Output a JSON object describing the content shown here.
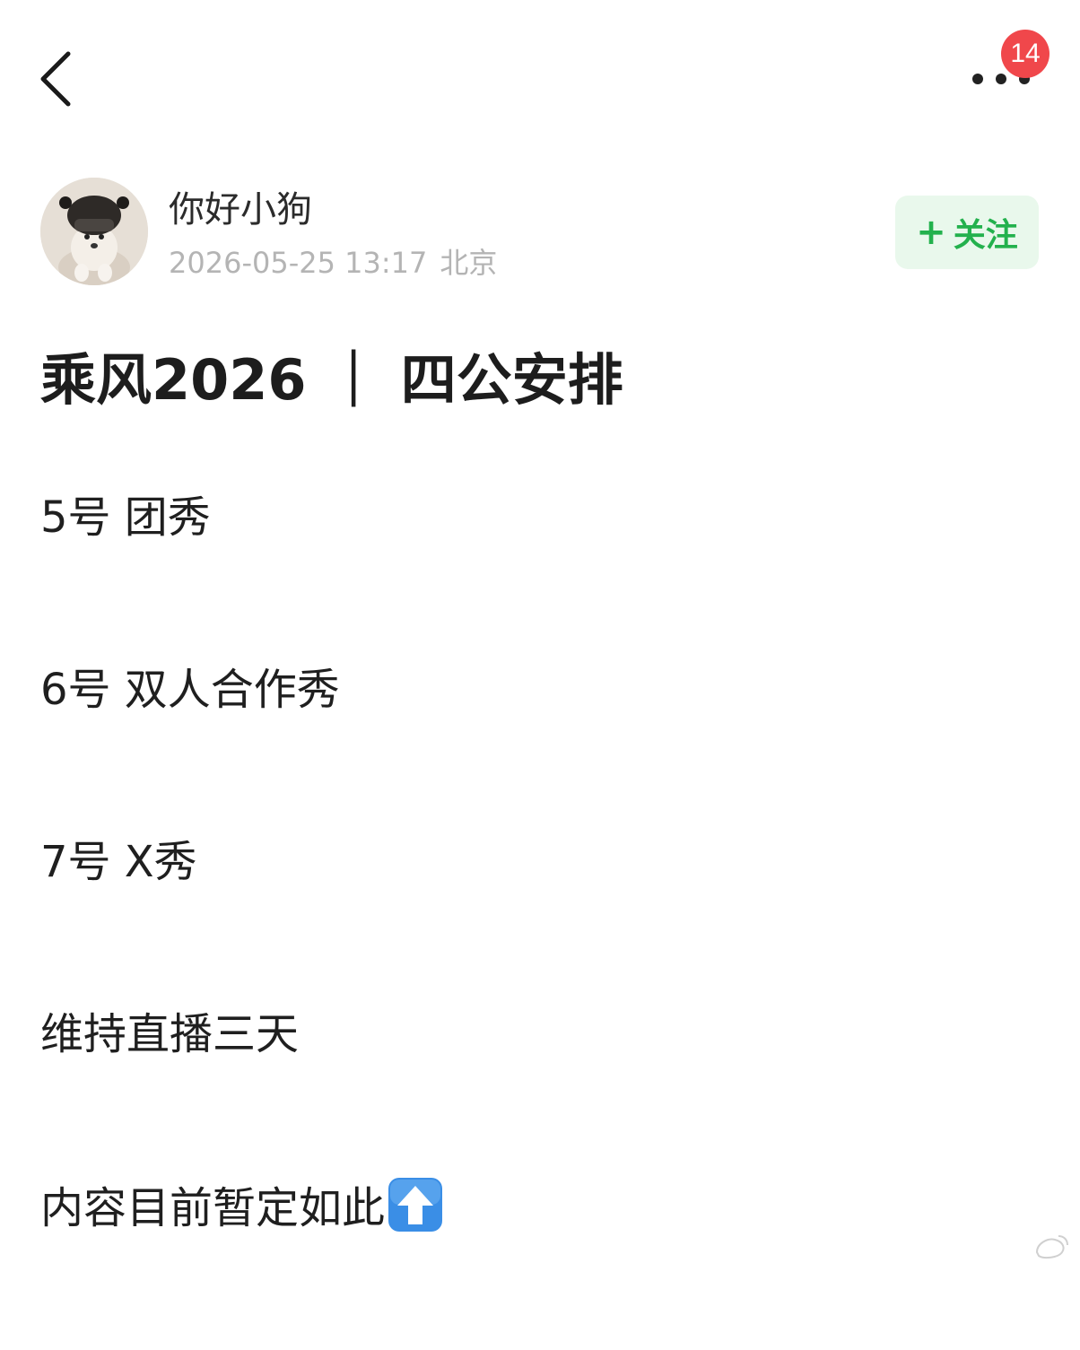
{
  "header": {
    "notification_count": "14"
  },
  "author": {
    "name": "你好小狗",
    "timestamp": "2026-05-25 13:17",
    "location": "北京",
    "follow_label": "关注",
    "follow_icon": "plus-icon"
  },
  "post": {
    "title": "乘风2026 ｜ 四公安排",
    "lines": [
      "5号 团秀",
      "6号 双人合作秀",
      "7号 X秀",
      "维持直播三天",
      "内容目前暂定如此"
    ],
    "trailing_emoji": "up-arrow-emoji"
  },
  "colors": {
    "accent_green": "#23b14d",
    "follow_bg": "#e9f8ec",
    "badge_red": "#f0474b",
    "meta_gray": "#b4b4b4"
  }
}
